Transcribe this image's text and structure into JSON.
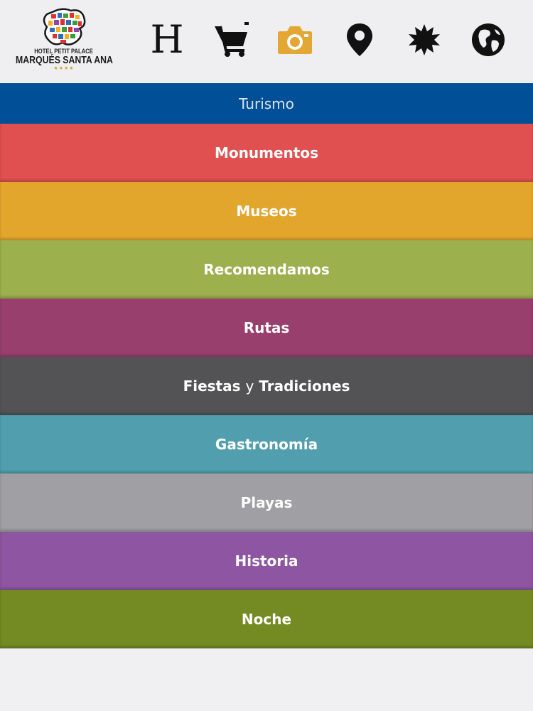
{
  "logo": {
    "line1": "HOTEL PETIT PALACE",
    "line2": "MARQUÉS SANTA ANA",
    "stars": "★★★★"
  },
  "toolbar": {
    "icons": [
      {
        "name": "hotel-h-icon",
        "glyph": "H",
        "color": "#111111"
      },
      {
        "name": "shopping-cart-icon",
        "color": "#111111"
      },
      {
        "name": "camera-icon",
        "color": "#e3a734",
        "active": true
      },
      {
        "name": "map-pin-icon",
        "color": "#111111"
      },
      {
        "name": "starburst-icon",
        "color": "#111111"
      },
      {
        "name": "globe-icon",
        "color": "#111111"
      }
    ]
  },
  "menu": {
    "title": "Turismo",
    "title_color": "#004f97",
    "items": [
      {
        "label": "Monumentos",
        "color": "#e05050"
      },
      {
        "label": "Museos",
        "color": "#e3a62d"
      },
      {
        "label": "Recomendamos",
        "color": "#9cb04e"
      },
      {
        "label": "Rutas",
        "color": "#983f6e"
      },
      {
        "label_a": "Fiestas",
        "label_conj": "y",
        "label_b": "Tradiciones",
        "color": "#535355"
      },
      {
        "label": "Gastronomía",
        "color": "#519fae"
      },
      {
        "label": "Playas",
        "color": "#a09fa3"
      },
      {
        "label": "Historia",
        "color": "#8e56a2"
      },
      {
        "label": "Noche",
        "color": "#748a23"
      }
    ]
  }
}
